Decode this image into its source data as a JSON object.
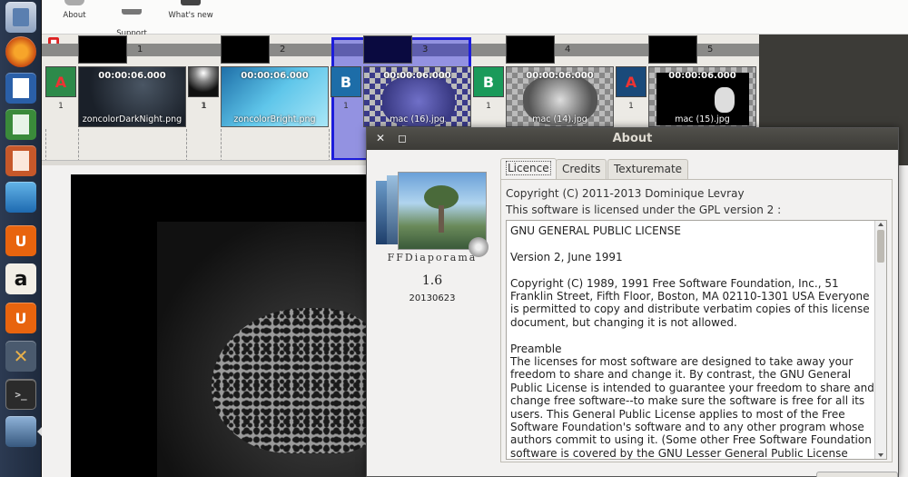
{
  "launcher": {
    "icons": [
      "files-icon",
      "firefox-icon",
      "writer-icon",
      "calc-icon",
      "impress-icon",
      "software-center-icon",
      "ubuntu-one-icon",
      "amazon-icon",
      "ubuntu-one-music-icon",
      "system-settings-icon",
      "terminal-icon",
      "ffdiaporama-icon"
    ],
    "amazon_letter": "a",
    "u_letter": "U"
  },
  "toolbar": {
    "about_label": "About",
    "support_label": "Support\nand help",
    "whats_new_label": "What's new"
  },
  "timeline": {
    "track_marker": "",
    "slides": [
      {
        "num": "1",
        "time": "00:00:06.000",
        "name": "zoncolorDarkNight.png",
        "trans_num": "1",
        "image_num": "1",
        "trans_letter": "A"
      },
      {
        "num": "2",
        "time": "00:00:06.000",
        "name": "zoncolorBright.png",
        "trans_num": "1",
        "image_num": "1",
        "trans_letter": ""
      },
      {
        "num": "3",
        "time": "00:00:06.000",
        "name": "mac (16).jpg",
        "trans_num": "1",
        "image_num": "1",
        "trans_letter": "B"
      },
      {
        "num": "4",
        "time": "00:00:06.000",
        "name": "mac (14).jpg",
        "trans_num": "1",
        "image_num": "1",
        "trans_letter": "B"
      },
      {
        "num": "5",
        "time": "00:00:06.000",
        "name": "mac (15).jpg",
        "trans_num": "1",
        "image_num": "1",
        "trans_letter": "A"
      }
    ]
  },
  "about_dialog": {
    "title": "About",
    "close_glyph": "✕",
    "max_glyph": "◻",
    "logo_text": "FFDiaporama",
    "version": "1.6",
    "build_date": "20130623",
    "tabs": [
      "Licence",
      "Credits",
      "Texturemate"
    ],
    "copyright": "Copyright (C) 2011-2013 Dominique Levray",
    "license_line": "This software is licensed under the GPL version 2 :",
    "license_text": [
      "GNU GENERAL PUBLIC LICENSE",
      "Version 2, June 1991",
      "Copyright (C) 1989, 1991 Free Software Foundation, Inc., 51 Franklin Street, Fifth Floor, Boston, MA 02110-1301 USA Everyone is permitted to copy and distribute verbatim copies of this license document, but changing it is not allowed.",
      "Preamble\nThe licenses for most software are designed to take away your freedom to share and change it. By contrast, the GNU General Public License is intended to guarantee your freedom to share and change free software--to make sure the software is free for all its users. This General Public License applies to most of the Free Software Foundation's software and to any other program whose authors commit to using it. (Some other Free Software Foundation software is covered by the GNU Lesser General Public License"
    ]
  }
}
